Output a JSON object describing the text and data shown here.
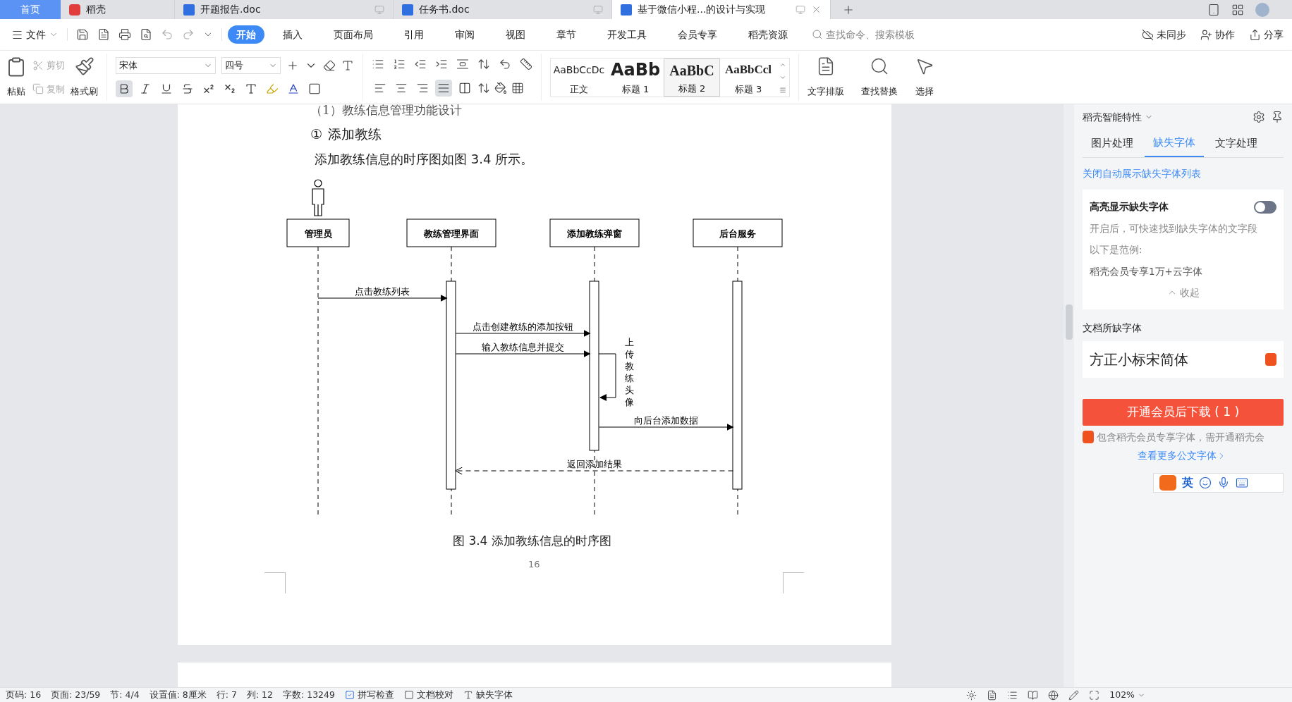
{
  "tabs": [
    {
      "kind": "home",
      "label": "首页",
      "selected": false
    },
    {
      "kind": "app",
      "label": "稻壳",
      "selected": false
    },
    {
      "kind": "doc",
      "label": "开题报告.doc",
      "selected": false
    },
    {
      "kind": "doc",
      "label": "任务书.doc",
      "selected": false
    },
    {
      "kind": "doc",
      "label": "基于微信小程...的设计与实现",
      "selected": true
    }
  ],
  "menu": {
    "file": "文件",
    "ribbon_tabs": [
      {
        "label": "开始",
        "selected": true
      },
      {
        "label": "插入",
        "selected": false
      },
      {
        "label": "页面布局",
        "selected": false
      },
      {
        "label": "引用",
        "selected": false
      },
      {
        "label": "审阅",
        "selected": false
      },
      {
        "label": "视图",
        "selected": false
      },
      {
        "label": "章节",
        "selected": false
      },
      {
        "label": "开发工具",
        "selected": false
      },
      {
        "label": "会员专享",
        "selected": false
      },
      {
        "label": "稻壳资源",
        "selected": false
      }
    ],
    "search": {
      "placeholder": "查找命令、搜索模板"
    },
    "actions": [
      {
        "kind": "sync",
        "label": "未同步"
      },
      {
        "kind": "collab",
        "label": "协作"
      },
      {
        "kind": "share",
        "label": "分享"
      }
    ]
  },
  "ribbon": {
    "paste": "粘贴",
    "cut": {
      "label": "剪切",
      "disabled": true
    },
    "copy": {
      "label": "复制",
      "disabled": true
    },
    "format_painter": "格式刷",
    "font": "宋体",
    "size": "四号",
    "format_buttons": [
      {
        "kind": "bold",
        "selected": true
      },
      {
        "kind": "italic",
        "selected": false
      },
      {
        "kind": "underline",
        "selected": false
      },
      {
        "kind": "strike",
        "selected": false
      },
      {
        "kind": "sup",
        "selected": false
      },
      {
        "kind": "sub",
        "selected": false
      },
      {
        "kind": "effect",
        "selected": false
      },
      {
        "kind": "highlight",
        "selected": false
      },
      {
        "kind": "color",
        "selected": false
      },
      {
        "kind": "border",
        "selected": false
      }
    ],
    "align_buttons": [
      {
        "kind": "left",
        "selected": false
      },
      {
        "kind": "center",
        "selected": false
      },
      {
        "kind": "right",
        "selected": false
      },
      {
        "kind": "justify",
        "selected": true
      },
      {
        "kind": "distribute",
        "selected": false
      }
    ],
    "styles": [
      {
        "sample": "AaBbCcDc",
        "label": "正文",
        "kind": "normal",
        "selected": false
      },
      {
        "sample": "AaBb",
        "label": "标题 1",
        "kind": "h1",
        "selected": false
      },
      {
        "sample": "AaBbC",
        "label": "标题 2",
        "kind": "h2",
        "selected": true
      },
      {
        "sample": "AaBbCcl",
        "label": "标题 3",
        "kind": "h3",
        "selected": false
      }
    ],
    "tools": [
      {
        "kind": "layout",
        "label": "文字排版"
      },
      {
        "kind": "find",
        "label": "查找替换"
      },
      {
        "kind": "select",
        "label": "选择"
      }
    ]
  },
  "document": {
    "heading": "（1）教练信息管理功能设计",
    "subheading_mark": "①",
    "subheading": "添加教练",
    "paragraph": "添加教练信息的时序图如图 3.4 所示。",
    "diagram": {
      "participants": [
        "管理员",
        "教练管理界面",
        "添加教练弹窗",
        "后台服务"
      ],
      "messages": [
        {
          "kind": "sync",
          "text": "点击教练列表"
        },
        {
          "kind": "sync",
          "text": "点击创建教练的添加按钮"
        },
        {
          "kind": "sync",
          "text": "输入教练信息并提交"
        },
        {
          "kind": "self",
          "text": "上传教练头像"
        },
        {
          "kind": "sync",
          "text": "向后台添加数据"
        },
        {
          "kind": "return",
          "text": "返回添加结果"
        }
      ]
    },
    "caption": "图 3.4 添加教练信息的时序图",
    "page_number": "16"
  },
  "panel": {
    "title": "稻壳智能特性",
    "tabs": [
      {
        "label": "图片处理",
        "selected": false
      },
      {
        "label": "缺失字体",
        "selected": true
      },
      {
        "label": "文字处理",
        "selected": false
      }
    ],
    "link": "关闭自动展示缺失字体列表",
    "toggle": {
      "label": "高亮显示缺失字体",
      "on": false
    },
    "description": "开启后，可快速找到缺失字体的文字段",
    "example_label": "以下是范例:",
    "example": "稻壳会员专享1万+云字体",
    "collapse": "收起",
    "section": "文档所缺字体",
    "fonts": [
      "方正小标宋简体"
    ],
    "download": "开通会员后下载 ( 1 )",
    "note": "包含稻壳会员专享字体，需开通稻壳会",
    "more": "查看更多公文字体",
    "ime": "英"
  },
  "status_bar": [
    {
      "kind": "text",
      "label": "页码: 16"
    },
    {
      "kind": "text",
      "label": "页面: 23/59"
    },
    {
      "kind": "text",
      "label": "节: 4/4"
    },
    {
      "kind": "text",
      "label": "设置值: 8厘米"
    },
    {
      "kind": "text",
      "label": "行: 7"
    },
    {
      "kind": "text",
      "label": "列: 12"
    },
    {
      "kind": "text",
      "label": "字数: 13249"
    },
    {
      "kind": "check",
      "label": "拼写检查",
      "checked": true
    },
    {
      "kind": "check",
      "label": "文档校对",
      "checked": false
    },
    {
      "kind": "font",
      "label": "缺失字体"
    }
  ],
  "zoom": "102%"
}
